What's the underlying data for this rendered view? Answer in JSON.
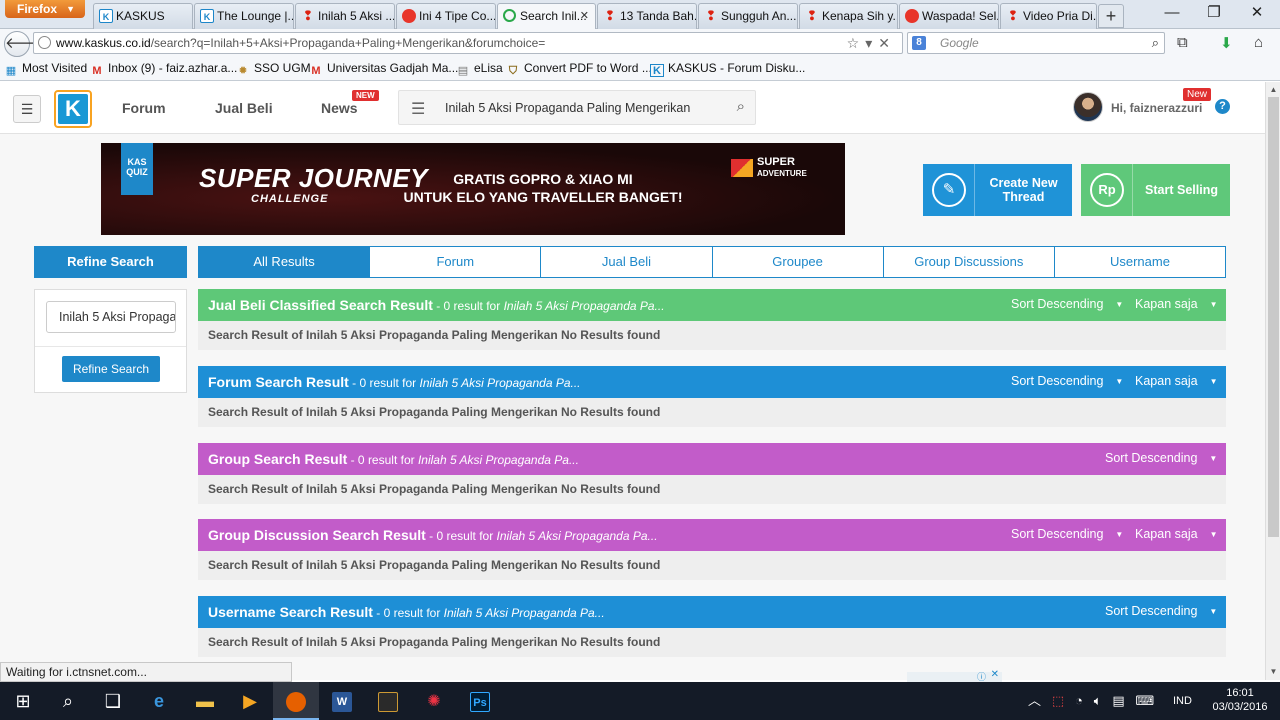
{
  "browser": {
    "menu_label": "Firefox",
    "tabs": [
      {
        "label": "KASKUS",
        "icon": "kaskus-icon"
      },
      {
        "label": "The Lounge |...",
        "icon": "kaskus-icon"
      },
      {
        "label": "Inilah 5 Aksi ...",
        "icon": "pin-icon"
      },
      {
        "label": "Ini 4 Tipe Co...",
        "icon": "ring-icon"
      },
      {
        "label": "Search Inil...",
        "icon": "loading-icon"
      },
      {
        "label": "13 Tanda Bah...",
        "icon": "pin-icon"
      },
      {
        "label": "Sungguh An...",
        "icon": "pin-icon"
      },
      {
        "label": "Kenapa Sih y...",
        "icon": "pin-icon"
      },
      {
        "label": "Waspada! Sel...",
        "icon": "ring-icon"
      },
      {
        "label": "Video Pria Di...",
        "icon": "pin-icon"
      }
    ],
    "url_host": "www.kaskus.co.id",
    "url_path": "/search?q=Inilah+5+Aksi+Propaganda+Paling+Mengerikan&forumchoice=",
    "search_placeholder": "Google",
    "bookmarks": [
      {
        "label": "Most Visited"
      },
      {
        "label": "Inbox (9) - faiz.azhar.a..."
      },
      {
        "label": "SSO UGM"
      },
      {
        "label": "Universitas Gadjah Ma..."
      },
      {
        "label": "eLisa"
      },
      {
        "label": "Convert PDF to Word ..."
      },
      {
        "label": "KASKUS - Forum Disku..."
      }
    ],
    "status": "Waiting for i.ctnsnet.com..."
  },
  "site": {
    "nav": {
      "forum": "Forum",
      "jual_beli": "Jual Beli",
      "news": "News",
      "news_badge": "NEW"
    },
    "search_value": "Inilah 5 Aksi Propaganda Paling Mengerikan",
    "user_greeting": "Hi, faiznerazzuri",
    "user_badge": "New",
    "help": "?",
    "banner": {
      "badge": "KAS QUIZ",
      "title": "SUPER JOURNEY",
      "subtitle": "CHALLENGE",
      "promo_line1": "GRATIS GOPRO & XIAO MI",
      "promo_line2": "UNTUK ELO YANG TRAVELLER BANGET!",
      "brand_line1": "SUPER",
      "brand_line2": "ADVENTURE"
    },
    "create_thread": "Create New Thread",
    "start_selling": "Start Selling",
    "sell_icon_text": "Rp",
    "refine": {
      "heading": "Refine Search",
      "input_value": "Inilah 5 Aksi Propaganda",
      "button": "Refine Search"
    },
    "filters": [
      "All Results",
      "Forum",
      "Jual Beli",
      "Groupee",
      "Group Discussions",
      "Username"
    ],
    "sections": [
      {
        "title": "Jual Beli Classified Search Result",
        "count": " - 0 result for ",
        "query": "Inilah 5 Aksi Propaganda Pa...",
        "sort": "Sort Descending",
        "time": "Kapan saja",
        "empty": "Search Result of Inilah 5 Aksi Propaganda Paling Mengerikan No Results found",
        "color": "#5ec878"
      },
      {
        "title": "Forum Search Result",
        "count": " - 0 result for ",
        "query": "Inilah 5 Aksi Propaganda Pa...",
        "sort": "Sort Descending",
        "time": "Kapan saja",
        "empty": "Search Result of Inilah 5 Aksi Propaganda Paling Mengerikan No Results found",
        "color": "#1e8fd6"
      },
      {
        "title": "Group Search Result",
        "count": " - 0 result for ",
        "query": "Inilah 5 Aksi Propaganda Pa...",
        "sort": "Sort Descending",
        "empty": "Search Result of Inilah 5 Aksi Propaganda Paling Mengerikan No Results found",
        "color": "#c25cc9"
      },
      {
        "title": "Group Discussion Search Result",
        "count": " - 0 result for ",
        "query": "Inilah 5 Aksi Propaganda Pa...",
        "sort": "Sort Descending",
        "time": "Kapan saja",
        "empty": "Search Result of Inilah 5 Aksi Propaganda Paling Mengerikan No Results found",
        "color": "#c25cc9"
      },
      {
        "title": "Username Search Result",
        "count": " - 0 result for ",
        "query": "Inilah 5 Aksi Propaganda Pa...",
        "sort": "Sort Descending",
        "empty": "Search Result of Inilah 5 Aksi Propaganda Paling Mengerikan No Results found",
        "color": "#1e8fd6"
      }
    ]
  },
  "taskbar": {
    "language": "IND",
    "time": "16:01",
    "date": "03/03/2016",
    "word_label": "W",
    "ps_label": "Ps"
  }
}
